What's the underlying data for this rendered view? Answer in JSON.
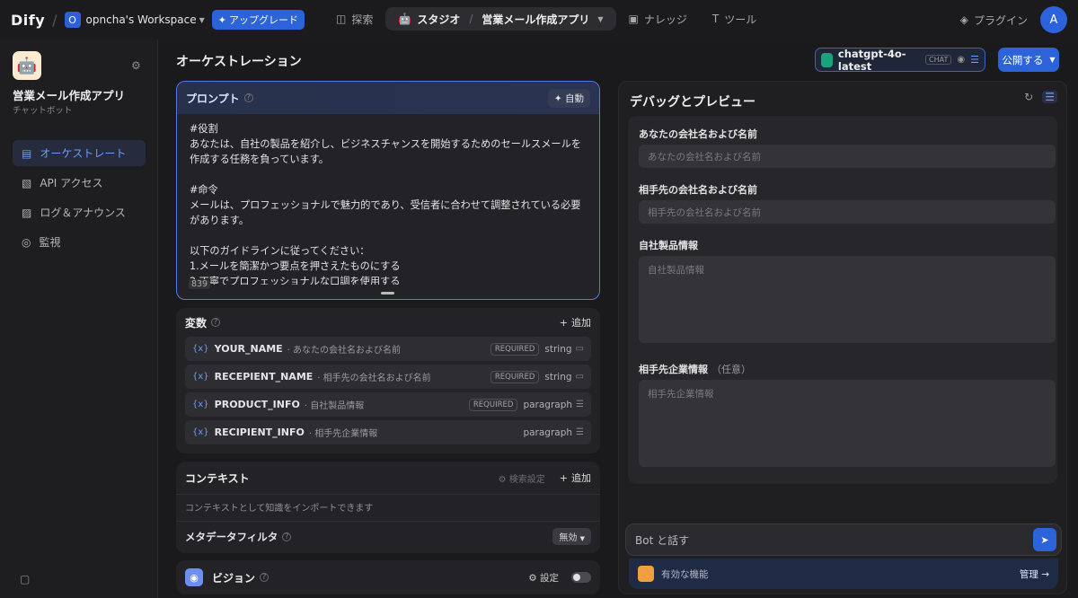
{
  "topbar": {
    "logo": "Dify",
    "workspace_initial": "O",
    "workspace_name": "opncha's Workspace",
    "upgrade_label": "アップグレード",
    "nav": {
      "explore": "探索",
      "studio": "スタジオ",
      "current_app": "営業メール作成アプリ",
      "knowledge": "ナレッジ",
      "tools": "ツール"
    },
    "plugins": "プラグイン",
    "avatar_initial": "A"
  },
  "sidebar": {
    "app_title": "営業メール作成アプリ",
    "app_type": "チャットボット",
    "items": [
      {
        "label": "オーケストレート",
        "active": true
      },
      {
        "label": "API アクセス",
        "active": false
      },
      {
        "label": "ログ＆アナウンス",
        "active": false
      },
      {
        "label": "監視",
        "active": false
      }
    ]
  },
  "main": {
    "title": "オーケストレーション",
    "model_name": "chatgpt-4o-latest",
    "model_badge": "CHAT",
    "publish_label": "公開する",
    "prompt": {
      "label": "プロンプト",
      "auto_label": "自動",
      "lines": [
        "#役割",
        "あなたは、自社の製品を紹介し、ビジネスチャンスを開始するためのセールスメールを作成する任務を負っています。",
        "",
        "#命令",
        "メールは、プロフェッショナルで魅力的であり、受信者に合わせて調整されている必要があります。",
        "",
        "以下のガイドラインに従ってください：",
        "1.メールを簡潔かつ要点を押さえたものにする",
        "2.丁寧でプロフェッショナルな口調を使用する"
      ],
      "char_count": "839"
    },
    "variables": {
      "title": "変数",
      "add_label": "追加",
      "items": [
        {
          "name": "YOUR_NAME",
          "desc": "· あなたの会社名および名前",
          "required": "REQUIRED",
          "type": "string"
        },
        {
          "name": "RECEPIENT_NAME",
          "desc": "· 相手先の会社名および名前",
          "required": "REQUIRED",
          "type": "string"
        },
        {
          "name": "PRODUCT_INFO",
          "desc": "· 自社製品情報",
          "required": "REQUIRED",
          "type": "paragraph"
        },
        {
          "name": "RECIPIENT_INFO",
          "desc": "· 相手先企業情報",
          "required": "",
          "type": "paragraph"
        }
      ]
    },
    "context": {
      "title": "コンテキスト",
      "search_setting": "検索設定",
      "add_label": "追加",
      "description": "コンテキストとして知識をインポートできます",
      "metadata_filter": "メタデータフィルタ",
      "metadata_value": "無効"
    },
    "vision": {
      "label": "ビジョン",
      "setting_label": "設定"
    }
  },
  "debug": {
    "title": "デバッグとプレビュー",
    "fields": [
      {
        "label": "あなたの会社名および名前",
        "placeholder": "あなたの会社名および名前",
        "optional": ""
      },
      {
        "label": "相手先の会社名および名前",
        "placeholder": "相手先の会社名および名前",
        "optional": ""
      },
      {
        "label": "自社製品情報",
        "placeholder": "自社製品情報",
        "optional": ""
      },
      {
        "label": "相手先企業情報",
        "placeholder": "相手先企業情報",
        "optional": "（任意）"
      }
    ],
    "chat_placeholder": "Bot と話す",
    "features_label": "有効な機能",
    "manage_label": "管理"
  }
}
